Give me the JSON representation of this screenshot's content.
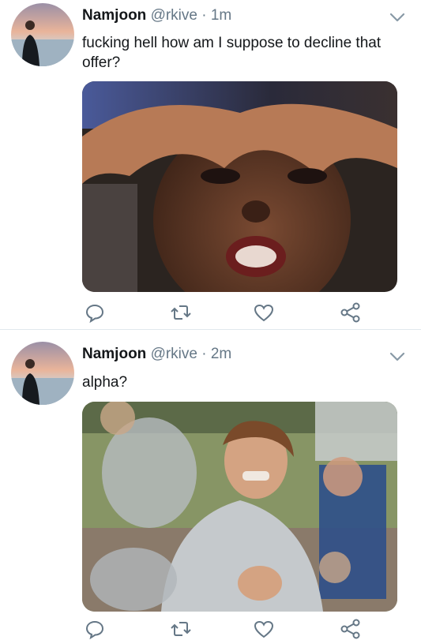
{
  "tweets": [
    {
      "user": {
        "name": "Namjoon",
        "handle": "@rkive",
        "separator": "·",
        "time": "1m"
      },
      "text": "fucking hell how am I suppose to decline that offer?",
      "icons": {
        "reply": "reply-icon",
        "retweet": "retweet-icon",
        "like": "heart-icon",
        "share": "share-icon",
        "menu": "chevron-down-icon"
      }
    },
    {
      "user": {
        "name": "Namjoon",
        "handle": "@rkive",
        "separator": "·",
        "time": "2m"
      },
      "text": "alpha?",
      "icons": {
        "reply": "reply-icon",
        "retweet": "retweet-icon",
        "like": "heart-icon",
        "share": "share-icon",
        "menu": "chevron-down-icon"
      }
    }
  ],
  "colors": {
    "text": "#14171a",
    "secondary": "#657786",
    "icon": "#657786",
    "divider": "#e1e8ed",
    "background": "#ffffff"
  }
}
